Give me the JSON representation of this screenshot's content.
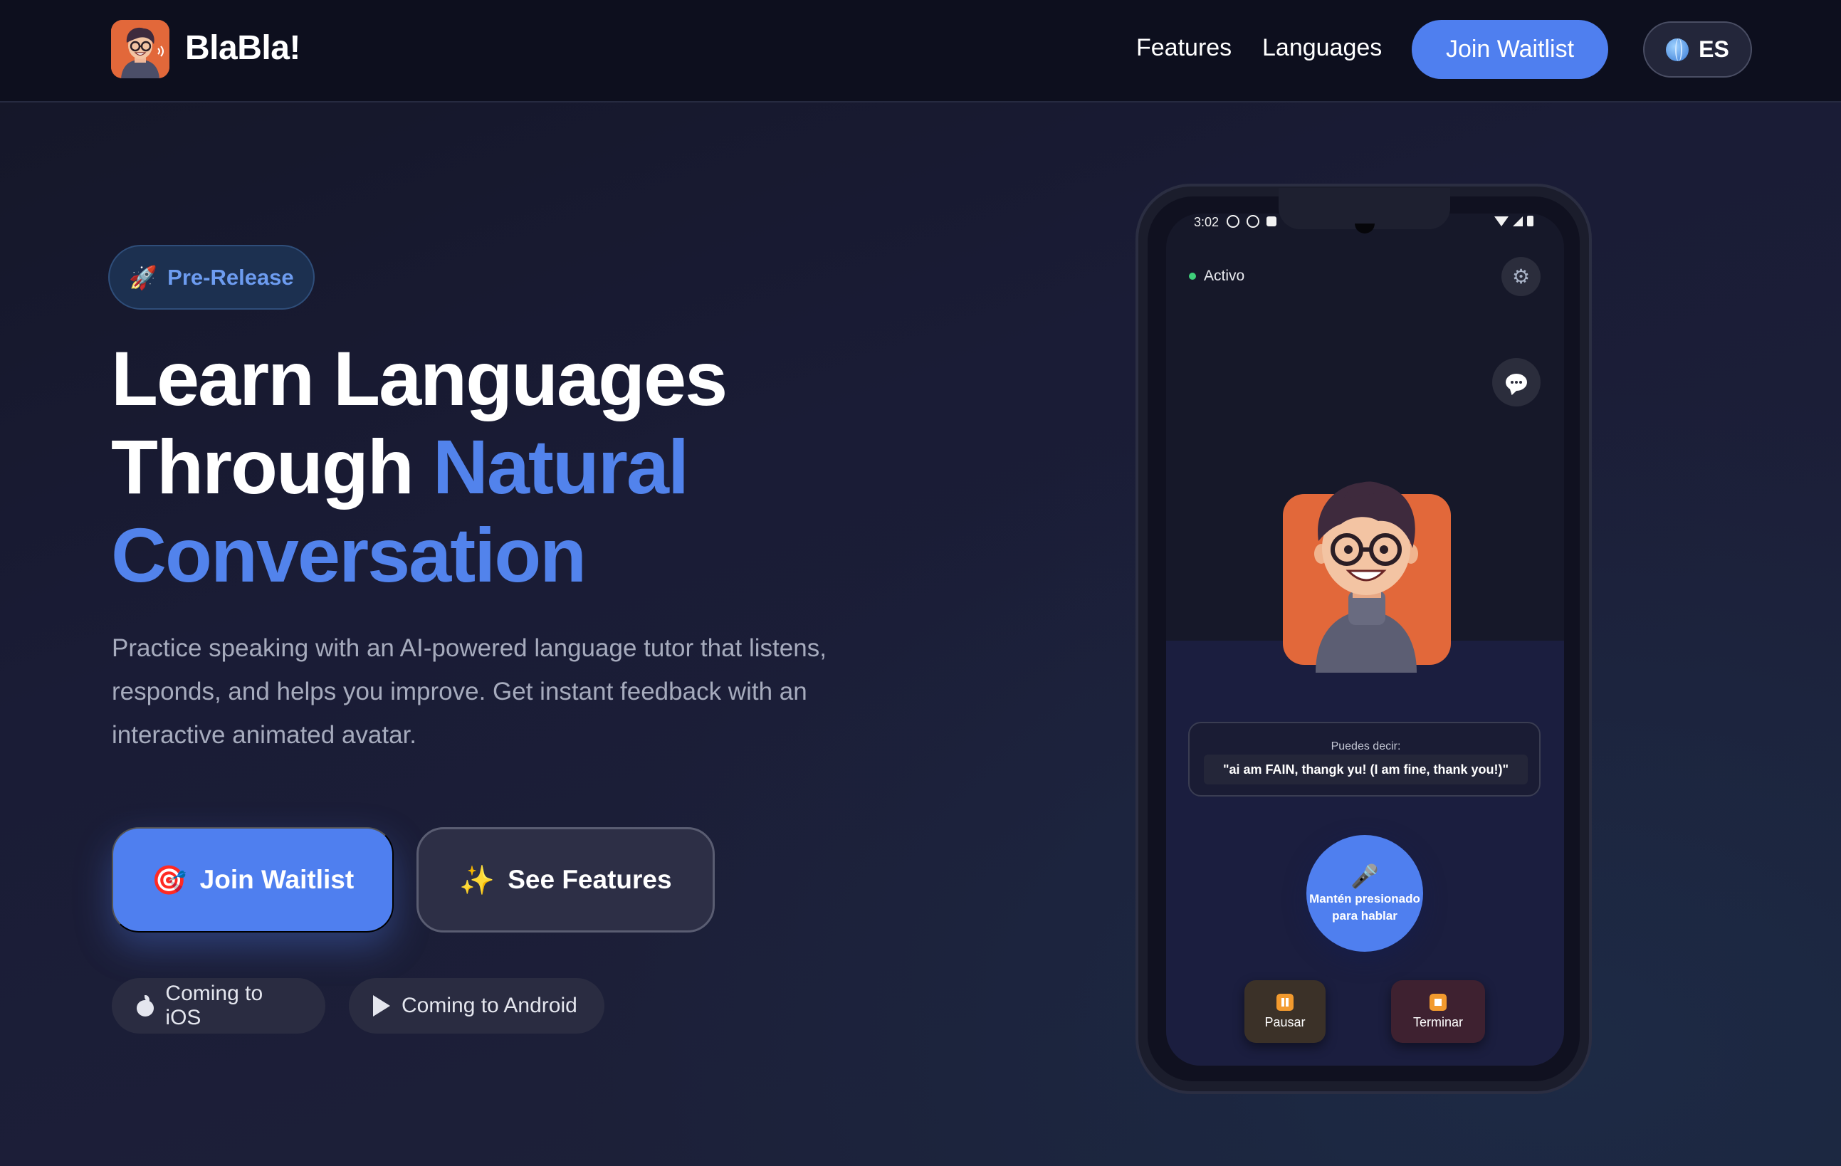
{
  "brand": {
    "name": "BlaBla!",
    "logo_icon": "avatar-logo-icon",
    "logo_color": "#e2683a"
  },
  "nav": {
    "features": "Features",
    "languages": "Languages",
    "join": "Join Waitlist",
    "language_code": "ES",
    "language_icon": "globe-icon"
  },
  "hero": {
    "badge": {
      "icon": "🚀",
      "label": "Pre-Release"
    },
    "headline_line1": "Learn Languages",
    "headline_line2a": "Through ",
    "headline_line2b": "Natural",
    "headline_line3": "Conversation",
    "subtitle": "Practice speaking with an AI-powered language tutor that listens, responds, and helps you improve. Get instant feedback with an interactive animated avatar.",
    "primary_cta": {
      "icon": "🎯",
      "label": "Join Waitlist"
    },
    "secondary_cta": {
      "icon": "✨",
      "label": "See Features"
    },
    "store_ios": "Coming to iOS",
    "store_android": "Coming to Android"
  },
  "phone": {
    "status_time": "3:02",
    "status_label": "Activo",
    "hint_label": "Puedes decir:",
    "hint_text": "\"ai am FAIN, thangk yu! (I am fine, thank you!)\"",
    "mic_icon": "🎤",
    "mic_line1": "Mantén presionado",
    "mic_line2": "para hablar",
    "pause_label": "Pausar",
    "stop_label": "Terminar"
  },
  "colors": {
    "accent": "#4f7fef",
    "headline_accent": "#5283ec",
    "status_active": "#3fcf7a",
    "control_icon": "#f29a2e"
  }
}
